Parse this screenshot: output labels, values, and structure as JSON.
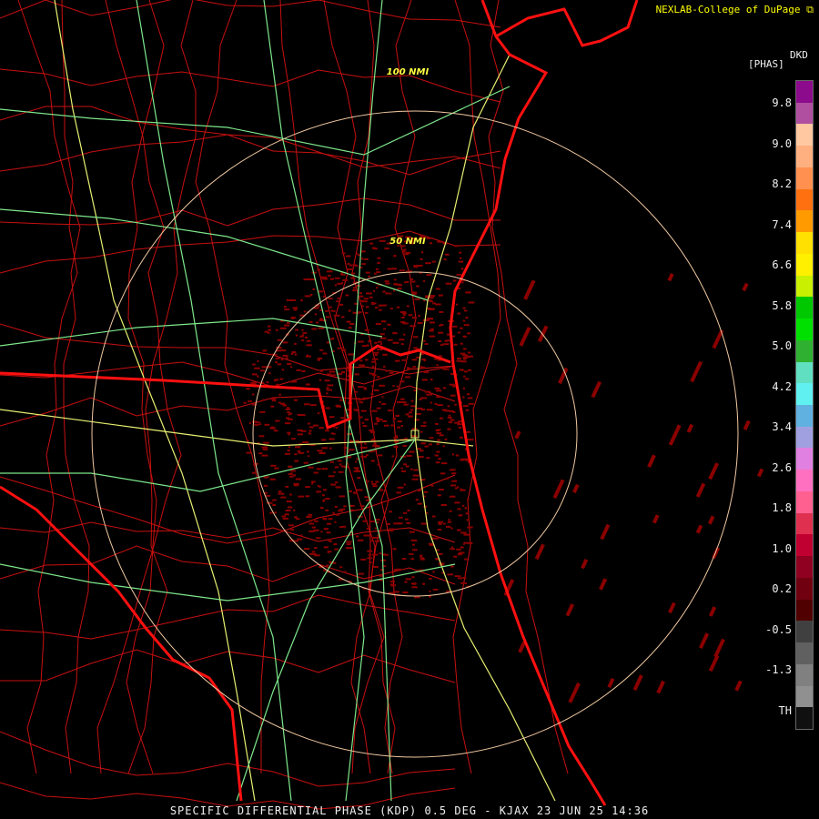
{
  "header": {
    "credit": "NEXLAB-College of DuPage",
    "credit_icon": "external-link-icon"
  },
  "caption": "SPECIFIC DIFFERENTIAL PHASE (KDP) 0.5 DEG - KJAX 23 JUN 25 14:36",
  "range_rings": [
    {
      "label": "100 NMI"
    },
    {
      "label": "50 NMI"
    }
  ],
  "legend": {
    "title": "DKD",
    "unit": "[PHAS]",
    "ticks": [
      "9.8",
      "9.0",
      "8.2",
      "7.4",
      "6.6",
      "5.8",
      "5.0",
      "4.2",
      "3.4",
      "2.6",
      "1.8",
      "1.0",
      "0.2",
      "-0.5",
      "-1.3",
      "TH"
    ],
    "colors": [
      "#8c0a8c",
      "#b04fa0",
      "#ffc8a0",
      "#ffb080",
      "#ff9050",
      "#ff7010",
      "#ff9a00",
      "#ffe000",
      "#fff000",
      "#c8f000",
      "#00c800",
      "#00e000",
      "#30b030",
      "#60e0c0",
      "#60f0f0",
      "#60b0e0",
      "#a0a0e0",
      "#e080e0",
      "#ff70c0",
      "#ff6090",
      "#e03050",
      "#c00030",
      "#900020",
      "#700010",
      "#500000",
      "#404040",
      "#606060",
      "#808080",
      "#909090",
      "#101010"
    ]
  },
  "colors": {
    "state_border": "#ff1010",
    "county": "#c81010",
    "highway": "#e8f070",
    "road": "#7ee88c",
    "ring": "#f0c8a0",
    "echo": "#8b0000"
  }
}
